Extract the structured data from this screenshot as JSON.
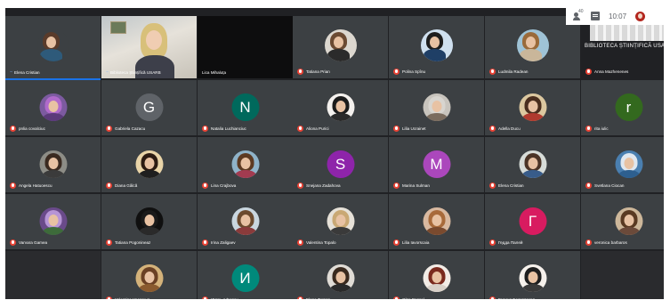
{
  "topbar": {
    "participant_count": "40",
    "clock": "10:07"
  },
  "tiles": [
    {
      "name": "Elena Cristian",
      "kind": "photo",
      "bg": "#3c4043",
      "hair": "#5a3b2a",
      "body": "#2e5a7a",
      "state": "level"
    },
    {
      "name": "Biblioteca Științifică USARB",
      "kind": "video",
      "state": "level"
    },
    {
      "name": "Lica Mihaluța",
      "kind": "empty-black",
      "state": "none"
    },
    {
      "name": "Tatiana Prian",
      "kind": "photo",
      "bg": "#dcd7cf",
      "hair": "#6b4a32",
      "body": "#2b2b2b",
      "state": "muted"
    },
    {
      "name": "Polina Spînu",
      "kind": "photo",
      "bg": "#cfe0ef",
      "hair": "#1e1e1e",
      "body": "#1f3f66",
      "state": "muted"
    },
    {
      "name": "Ludmila Radean",
      "kind": "photo",
      "bg": "#9fc3d6",
      "hair": "#9a6a3a",
      "body": "#c9b69a",
      "state": "muted"
    },
    {
      "name": "Anna Mazhenenes",
      "kind": "library",
      "label": "BIBLIOTECA ȘTIINȚIFICĂ USARB",
      "state": "muted"
    },
    {
      "name": "pnlia covalciuc",
      "kind": "photo",
      "bg": "#7c5aa0",
      "hair": "#b06acb",
      "body": "#5b3a7a",
      "state": "muted"
    },
    {
      "name": "Gabriela Cazacu",
      "kind": "letter",
      "letter": "G",
      "color": "#5f6368",
      "state": "muted"
    },
    {
      "name": "Natalia Luchianciuc",
      "kind": "letter",
      "letter": "N",
      "color": "#00695c",
      "state": "muted"
    },
    {
      "name": "Aliona Purici",
      "kind": "photo",
      "bg": "#f4f1ee",
      "hair": "#1b1b1b",
      "body": "#2a2a2a",
      "state": "muted"
    },
    {
      "name": "Lilia Ucrainet",
      "kind": "photo",
      "bg": "#c8c4bd",
      "hair": "#d8d5cf",
      "body": "#7a6b5d",
      "state": "muted"
    },
    {
      "name": "Adella Ducu",
      "kind": "photo",
      "bg": "#dcc8a0",
      "hair": "#4a2e1e",
      "body": "#b03a2e",
      "state": "muted"
    },
    {
      "name": "rita iulic",
      "kind": "letter",
      "letter": "r",
      "color": "#33691e",
      "state": "muted"
    },
    {
      "name": "Angela Hatuoescu",
      "kind": "photo",
      "bg": "#8d8d86",
      "hair": "#3a2a20",
      "body": "#3b3b3b",
      "state": "muted"
    },
    {
      "name": "Diana Gâlcă",
      "kind": "photo",
      "bg": "#e9d4a8",
      "hair": "#2c1b12",
      "body": "#1f1f1f",
      "state": "muted"
    },
    {
      "name": "Lina Crajbova",
      "kind": "photo",
      "bg": "#8fb3c9",
      "hair": "#5c3a22",
      "body": "#a23b50",
      "state": "muted"
    },
    {
      "name": "Snejana Zadahova",
      "kind": "letter",
      "letter": "S",
      "color": "#8e24aa",
      "state": "muted"
    },
    {
      "name": "Marina Sulman",
      "kind": "letter",
      "letter": "M",
      "color": "#ab47bc",
      "state": "muted"
    },
    {
      "name": "Elena Cristian",
      "kind": "photo",
      "bg": "#d7dcd8",
      "hair": "#4b3426",
      "body": "#385c8a",
      "state": "muted"
    },
    {
      "name": "Svetlana Ciocan",
      "kind": "photo",
      "bg": "#4a7fb0",
      "hair": "#e0e7ef",
      "body": "#2d5f8f",
      "state": "muted"
    },
    {
      "name": "Varvara Gamea",
      "kind": "photo",
      "bg": "#6a4a8a",
      "hair": "#b795d6",
      "body": "#3d6b3a",
      "state": "muted"
    },
    {
      "name": "Tatiana Pogonineaz",
      "kind": "photo",
      "bg": "#101010",
      "hair": "#1a1a1a",
      "body": "#2a2a2a",
      "state": "muted"
    },
    {
      "name": "Irina Zaligaev",
      "kind": "photo",
      "bg": "#c9d6df",
      "hair": "#6b4a2e",
      "body": "#8a3b3b",
      "state": "muted"
    },
    {
      "name": "Valentina Topalo",
      "kind": "photo",
      "bg": "#e6e1d8",
      "hair": "#c9a874",
      "body": "#3a3a3a",
      "state": "muted"
    },
    {
      "name": "Lilia Iavorscaia",
      "kind": "photo",
      "bg": "#d9b9a0",
      "hair": "#a86a3a",
      "body": "#7a4a2e",
      "state": "muted"
    },
    {
      "name": "Гедда Палей",
      "kind": "letter",
      "letter": "Г",
      "color": "#d81b60",
      "state": "muted"
    },
    {
      "name": "veronica barbaros",
      "kind": "photo",
      "bg": "#cdb79a",
      "hair": "#5a3a22",
      "body": "#6b4a3a",
      "state": "muted"
    },
    {
      "name": "Valentina Vacaruus",
      "kind": "photo",
      "bg": "#d4b27a",
      "hair": "#6a4024",
      "body": "#8a5a2e",
      "state": "muted"
    },
    {
      "name": "Игорь Афилин",
      "kind": "letter",
      "letter": "И",
      "color": "#00897b",
      "state": "muted"
    },
    {
      "name": "Elena Turcan",
      "kind": "photo",
      "bg": "#e0dcd6",
      "hair": "#3a2a1e",
      "body": "#2a2a2a",
      "state": "muted"
    },
    {
      "name": "Olga Bascal",
      "kind": "photo",
      "bg": "#f2ece6",
      "hair": "#7a2a1e",
      "body": "#d8d0c8",
      "state": "muted"
    },
    {
      "name": "Галина Белковская",
      "kind": "photo",
      "bg": "#f6f1ec",
      "hair": "#1e1e1e",
      "body": "#3a3a3a",
      "state": "muted"
    }
  ]
}
